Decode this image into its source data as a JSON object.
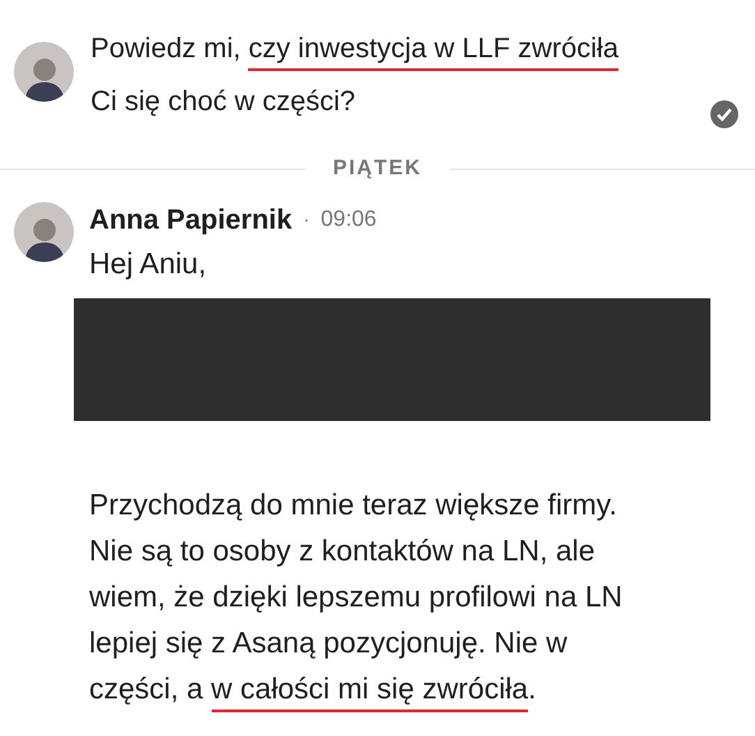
{
  "first_message": {
    "read": true,
    "paragraphs": [
      {
        "kind": "text",
        "segments": [
          {
            "text": "Powiedz mi, ",
            "underlined": false
          },
          {
            "text": "czy inwestycja w LLF zwróciła",
            "underlined": true
          },
          {
            "text": " Ci się choć w części?",
            "underlined": false
          }
        ]
      }
    ]
  },
  "day_divider": "PIĄTEK",
  "second_message": {
    "author": "Anna Papiernik",
    "separator": "·",
    "time": "09:06",
    "paragraphs": [
      {
        "kind": "text",
        "segments": [
          {
            "text": "Hej Aniu,",
            "underlined": false
          }
        ]
      },
      {
        "kind": "redacted"
      },
      {
        "kind": "text",
        "segments": [
          {
            "text": "Przychodzą do mnie teraz większe firmy. Nie są to osoby z kontaktów na LN, ale wiem, że dzięki lepszemu profilowi na LN lepiej się z Asaną pozycjonuję. Nie w części, a ",
            "underlined": false
          },
          {
            "text": "w całości mi się zwróciła",
            "underlined": true
          },
          {
            "text": ".",
            "underlined": false
          }
        ]
      }
    ]
  }
}
